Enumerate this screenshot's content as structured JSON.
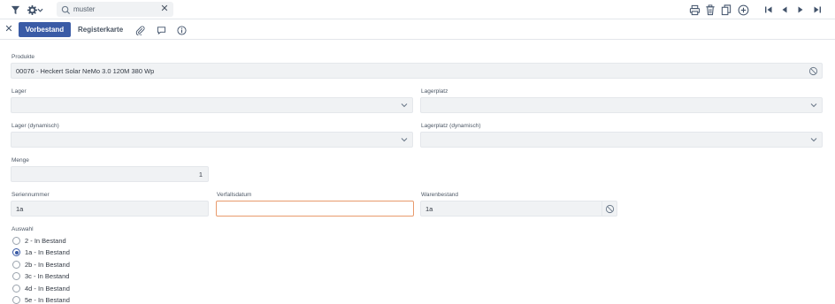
{
  "toolbar": {
    "search": {
      "value": "muster",
      "clear_glyph": "✕"
    },
    "icons": [
      "filter-icon",
      "gear-icon",
      "chevron-down-icon",
      "search-icon",
      "print-icon",
      "trash-icon",
      "copy-icon",
      "add-circle-icon",
      "first-page-icon",
      "prev-icon",
      "next-icon",
      "last-page-icon"
    ]
  },
  "tabs": {
    "close_glyph": "✕",
    "active": "Vorbestand",
    "second": "Registerkarte"
  },
  "form": {
    "produkte": {
      "label": "Produkte",
      "value": "00076 - Heckert Solar NeMo 3.0 120M 380 Wp"
    },
    "lager": {
      "label": "Lager",
      "value": ""
    },
    "lagerplatz": {
      "label": "Lagerplatz",
      "value": ""
    },
    "lager_dyn": {
      "label": "Lager (dynamisch)",
      "value": ""
    },
    "lagerplatz_dyn": {
      "label": "Lagerplatz (dynamisch)",
      "value": ""
    },
    "menge": {
      "label": "Menge",
      "value": "1"
    },
    "seriennummer": {
      "label": "Seriennummer",
      "value": "1a"
    },
    "verfallsdatum": {
      "label": "Verfallsdatum",
      "value": ""
    },
    "warenbestand": {
      "label": "Warenbestand",
      "value": "1a"
    },
    "auswahl": {
      "label": "Auswahl",
      "options": [
        {
          "label": "2 - In Bestand",
          "selected": false
        },
        {
          "label": "1a - In Bestand",
          "selected": true
        },
        {
          "label": "2b - In Bestand",
          "selected": false
        },
        {
          "label": "3c - In Bestand",
          "selected": false
        },
        {
          "label": "4d - In Bestand",
          "selected": false
        },
        {
          "label": "5e - In Bestand",
          "selected": false
        }
      ]
    }
  },
  "colors": {
    "accent": "#3a5ba6",
    "focus_border": "#e89a6c",
    "field_bg": "#f0f2f4"
  }
}
